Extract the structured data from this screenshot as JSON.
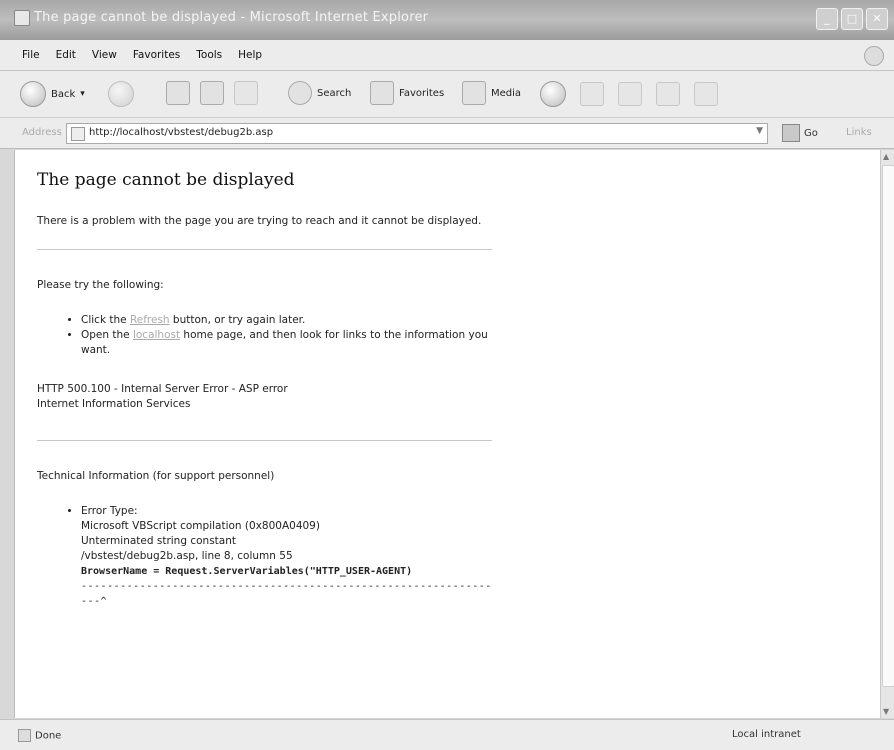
{
  "window": {
    "title": "The page cannot be displayed - Microsoft Internet Explorer"
  },
  "menu": [
    "File",
    "Edit",
    "View",
    "Favorites",
    "Tools",
    "Help"
  ],
  "toolbar": {
    "back_label": "Back",
    "search_label": "Search",
    "favorites_label": "Favorites",
    "media_label": "Media"
  },
  "address": {
    "label": "Address",
    "url": "http://localhost/vbstest/debug2b.asp",
    "go_label": "Go",
    "links_label": "Links"
  },
  "page": {
    "heading": "The page cannot be displayed",
    "intro": "There is a problem with the page you are trying to reach and it cannot be displayed.",
    "try_label": "Please try the following:",
    "bullet1_pre": "Click the ",
    "bullet1_link": "Refresh",
    "bullet1_post": " button, or try again later.",
    "bullet2_pre": "Open the ",
    "bullet2_link": "localhost",
    "bullet2_post": " home page, and then look for links to the information you want.",
    "error_line": "HTTP 500.100 - Internal Server Error - ASP error",
    "service_line": "Internet Information Services",
    "tech_label": "Technical Information (for support personnel)",
    "error_type_label": "Error Type:",
    "error_source": "Microsoft VBScript compilation (0x800A0409)",
    "error_desc": "Unterminated string constant",
    "error_location": "/vbstest/debug2b.asp, line 8, column 55",
    "code_line": "BrowserName = Request.ServerVariables(\"HTTP_USER-AGENT)",
    "stars_line": "------------------------------------------------------------------^"
  },
  "status": {
    "text": "Done",
    "zone": "Local intranet"
  }
}
